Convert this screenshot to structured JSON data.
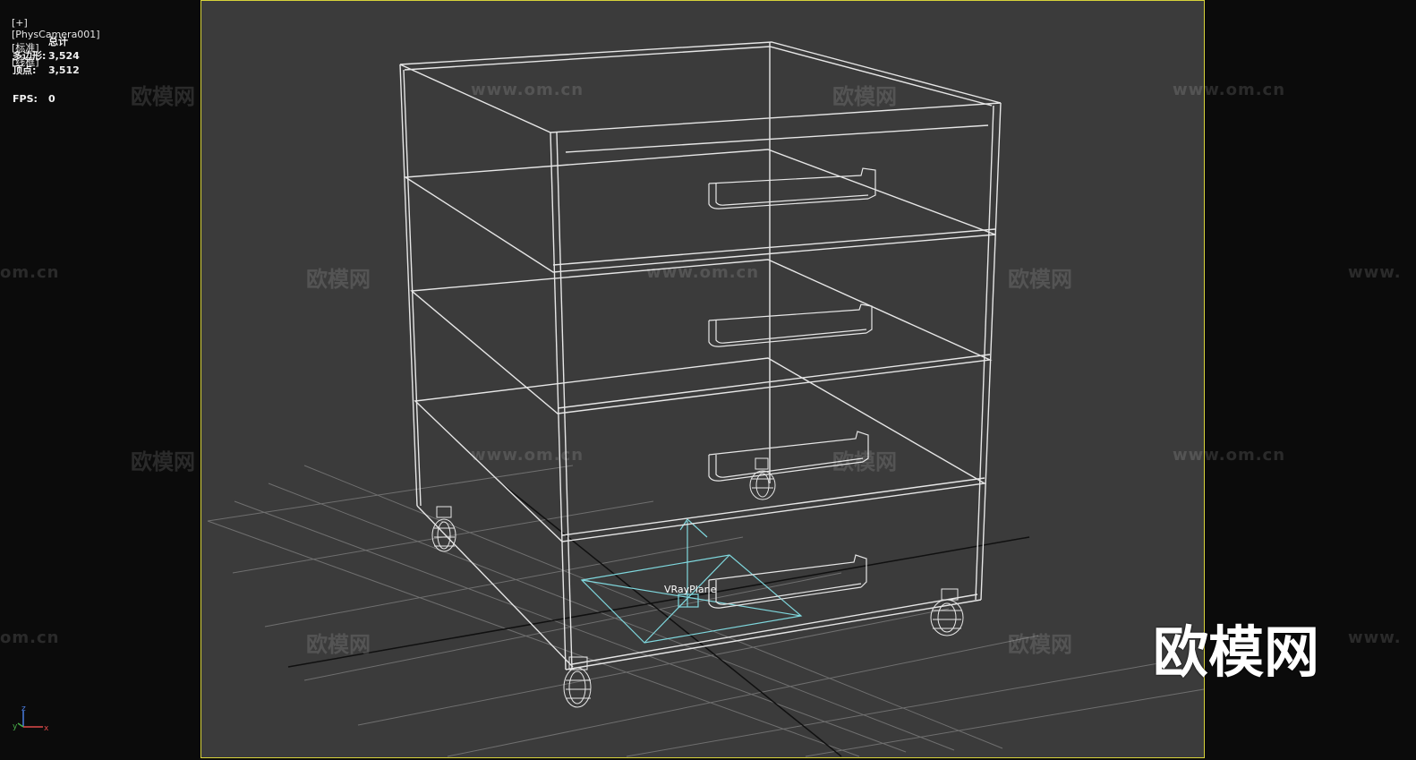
{
  "viewport": {
    "plus": "[+]",
    "camera": "[PhysCamera001]",
    "shading_mode": "[标准]",
    "render_mode": "[线框]"
  },
  "stats": {
    "header": "总计",
    "polygons_label": "多边形:",
    "polygons_value": "3,524",
    "vertices_label": "顶点:",
    "vertices_value": "3,512",
    "fps_label": "FPS:",
    "fps_value": "0"
  },
  "scene": {
    "object_label": "VRayPlane",
    "wireframe_color": "#e6e6e6",
    "grid_color": "#7a7a7a",
    "selected_color": "#7fd8de"
  },
  "axis_tripod": {
    "x": "x",
    "y": "y",
    "z": "z"
  },
  "watermarks": {
    "brand": "欧模网",
    "url": "www.om.cn",
    "partial_url_left": "om.cn",
    "partial_url_right": "www."
  },
  "logo": "欧模网",
  "colors": {
    "viewport_bg": "#3b3b3b",
    "outer_bg": "#0b0b0b",
    "safe_frame_border": "#d7d23a"
  }
}
